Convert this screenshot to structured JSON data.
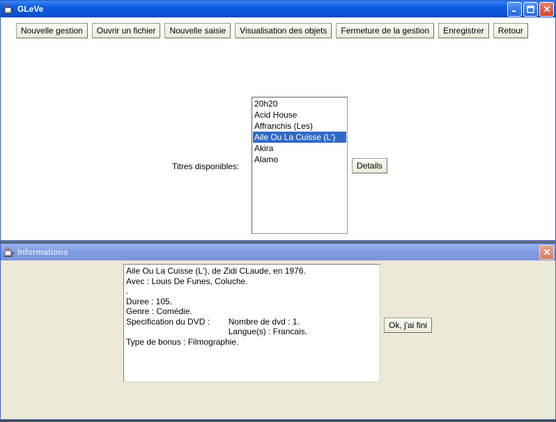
{
  "main_window": {
    "title": "GLeVe",
    "toolbar": [
      {
        "name": "nouvelle-gestion-button",
        "label": "Nouvelle gestion"
      },
      {
        "name": "ouvrir-fichier-button",
        "label": "Ouvrir un fichier"
      },
      {
        "name": "nouvelle-saisie-button",
        "label": "Nouvelle saisie"
      },
      {
        "name": "visualisation-objets-button",
        "label": "Visualisation des objets"
      },
      {
        "name": "fermeture-gestion-button",
        "label": "Fermeture de la gestion"
      },
      {
        "name": "enregistrer-button",
        "label": "Enregistrer"
      },
      {
        "name": "retour-button",
        "label": "Retour"
      }
    ],
    "titles_label": "Titres disponibles:",
    "titles": [
      "20h20",
      "Acid House",
      "Affranchis (Les)",
      "Aile Ou La Cuisse (L')",
      "Akira",
      "Alamo"
    ],
    "selected_index": 3,
    "details_label": "Details"
  },
  "info_window": {
    "title": "Informations",
    "lines": [
      "Aile Ou La Cuisse (L'), de Zidi CLaude, en 1976.",
      "Avec : Louis De Funes, Coluche.",
      ".",
      "Duree : 105.",
      "Genre : Comédie.",
      "Specification du DVD :        Nombre de dvd : 1.",
      "                                            Langue(s) : Francais.",
      "Type de bonus : Filmographie."
    ],
    "ok_label": "Ok, j'ai fini"
  },
  "colors": {
    "titlebar_active": "#0a5ce4",
    "selection": "#316ac5",
    "dialog_bg": "#ece9d8"
  }
}
